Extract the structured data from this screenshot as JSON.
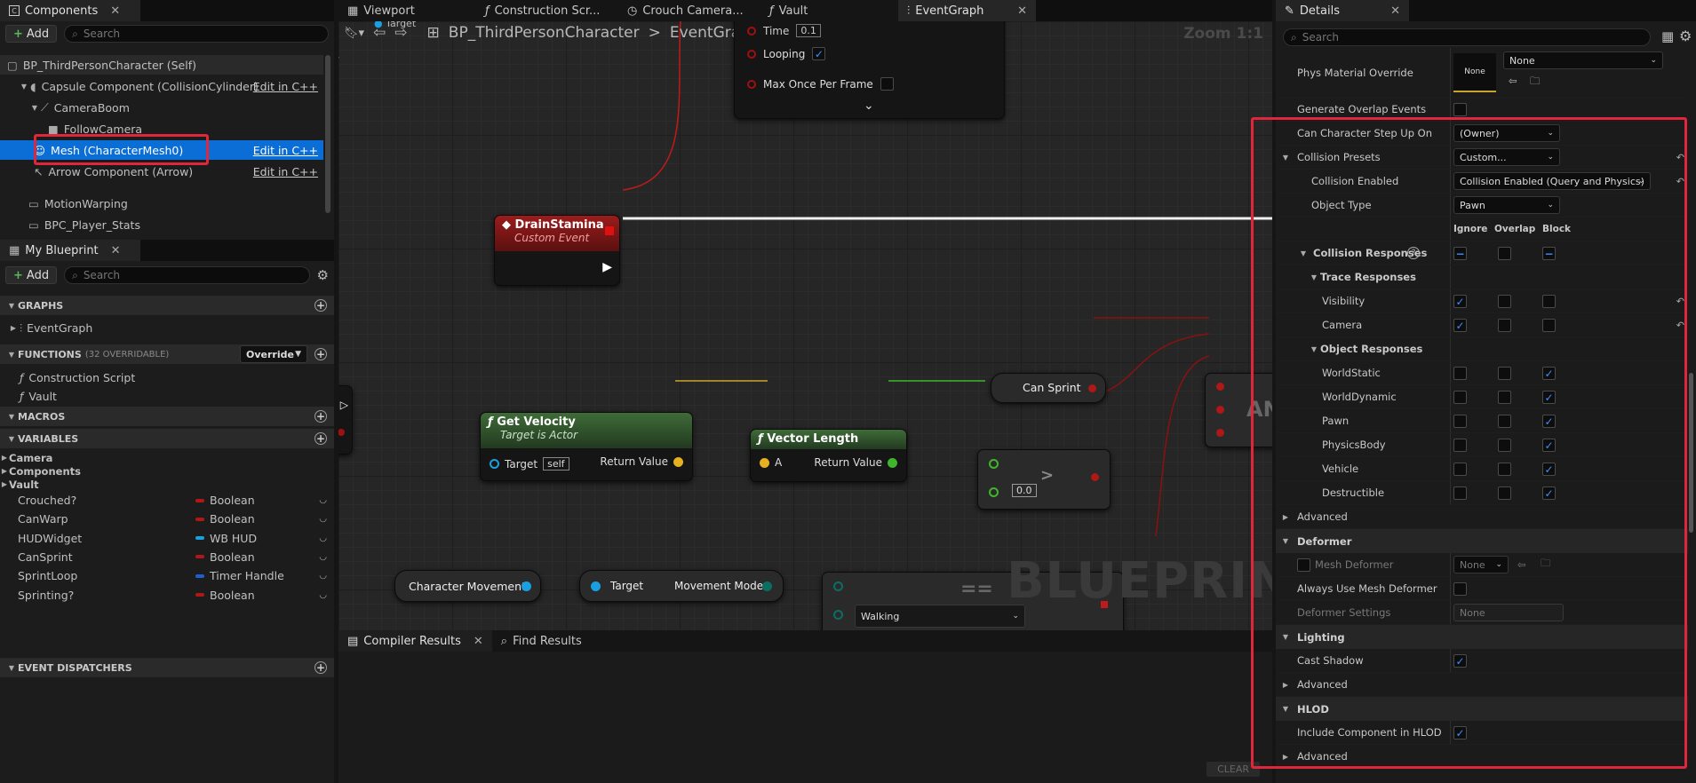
{
  "components": {
    "tab_label": "Components",
    "add_label": "Add",
    "search_placeholder": "Search",
    "items": [
      {
        "label": "BP_ThirdPersonCharacter (Self)",
        "edit": ""
      },
      {
        "label": "Capsule Component (CollisionCylinder)",
        "edit": "Edit in C++"
      },
      {
        "label": "CameraBoom",
        "edit": ""
      },
      {
        "label": "FollowCamera",
        "edit": ""
      },
      {
        "label": "Mesh (CharacterMesh0)",
        "edit": "Edit in C++"
      },
      {
        "label": "Arrow Component (Arrow)",
        "edit": "Edit in C++"
      },
      {
        "label": "MotionWarping",
        "edit": ""
      },
      {
        "label": "BPC_Player_Stats",
        "edit": ""
      }
    ]
  },
  "my_blueprint": {
    "tab_label": "My Blueprint",
    "add_label": "Add",
    "search_placeholder": "Search",
    "graphs_label": "GRAPHS",
    "graph_items": [
      "EventGraph"
    ],
    "functions_label": "FUNCTIONS",
    "functions_count": "(32 OVERRIDABLE)",
    "override_label": "Override",
    "function_items": [
      "Construction Script",
      "Vault"
    ],
    "macros_label": "MACROS",
    "variables_label": "VARIABLES",
    "categories": [
      "Camera",
      "Components",
      "Vault"
    ],
    "variables": [
      {
        "name": "Crouched?",
        "type": "Boolean",
        "color": "#b01818"
      },
      {
        "name": "CanWarp",
        "type": "Boolean",
        "color": "#b01818"
      },
      {
        "name": "HUDWidget",
        "type": "WB HUD",
        "color": "#1aa0e0"
      },
      {
        "name": "CanSprint",
        "type": "Boolean",
        "color": "#b01818"
      },
      {
        "name": "SprintLoop",
        "type": "Timer Handle",
        "color": "#1e5fd0"
      },
      {
        "name": "Sprinting?",
        "type": "Boolean",
        "color": "#b01818"
      }
    ],
    "dispatchers_label": "EVENT DISPATCHERS"
  },
  "editor_tabs": [
    "Viewport",
    "Construction Scr...",
    "Crouch Camera...",
    "Vault",
    "EventGraph"
  ],
  "breadcrumb": {
    "root": "BP_ThirdPersonCharacter",
    "separator": ">",
    "current": "EventGraph"
  },
  "zoom": "Zoom 1:1",
  "watermark": "BLUEPRINT",
  "graph": {
    "timer_rows": [
      "Time",
      "Looping",
      "Max Once Per Frame"
    ],
    "timer_time_value": "0.1",
    "top_target_label": "Target",
    "drain": {
      "title": "DrainStamina",
      "subtitle": "Custom Event"
    },
    "get_velocity": {
      "title": "Get Velocity",
      "subtitle": "Target is Actor",
      "target": "Target",
      "self": "self",
      "ret": "Return Value"
    },
    "vector_length": {
      "title": "Vector Length",
      "a": "A",
      "ret": "Return Value"
    },
    "greater": {
      "symbol": ">",
      "value": "0.0"
    },
    "can_sprint": "Can Sprint",
    "and_partial": "AN",
    "char_movement": "Character Movement",
    "movement_mode": {
      "target": "Target",
      "ret": "Movement Mode"
    },
    "walking": "Walking",
    "eq_partial": "=="
  },
  "bottom": {
    "compiler_tab": "Compiler Results",
    "find_tab": "Find Results",
    "clear_label": "CLEAR"
  },
  "details": {
    "tab_label": "Details",
    "search_placeholder": "Search",
    "phys_material_label": "Phys Material Override",
    "phys_thumb": "None",
    "phys_value": "None",
    "generate_overlap_label": "Generate Overlap Events",
    "can_step_label": "Can Character Step Up On",
    "can_step_value": "(Owner)",
    "collision_presets_label": "Collision Presets",
    "collision_presets_value": "Custom...",
    "collision_enabled_label": "Collision Enabled",
    "collision_enabled_value": "Collision Enabled (Query and Physics)",
    "object_type_label": "Object Type",
    "object_type_value": "Pawn",
    "col_headers": [
      "Ignore",
      "Overlap",
      "Block"
    ],
    "collision_responses_label": "Collision Responses",
    "trace_responses_label": "Trace Responses",
    "trace_rows": [
      {
        "name": "Visibility",
        "state": 0,
        "reset": true
      },
      {
        "name": "Camera",
        "state": 0,
        "reset": true
      }
    ],
    "object_responses_label": "Object Responses",
    "object_rows": [
      {
        "name": "WorldStatic",
        "state": 2
      },
      {
        "name": "WorldDynamic",
        "state": 2
      },
      {
        "name": "Pawn",
        "state": 2
      },
      {
        "name": "PhysicsBody",
        "state": 2
      },
      {
        "name": "Vehicle",
        "state": 2
      },
      {
        "name": "Destructible",
        "state": 2
      }
    ],
    "advanced_label": "Advanced",
    "deformer_label": "Deformer",
    "mesh_deformer_label": "Mesh Deformer",
    "mesh_deformer_value": "None",
    "always_use_label": "Always Use Mesh Deformer",
    "deformer_settings_label": "Deformer Settings",
    "deformer_settings_value": "None",
    "lighting_label": "Lighting",
    "cast_shadow_label": "Cast Shadow",
    "hlod_label": "HLOD",
    "include_hlod_label": "Include Component in HLOD"
  }
}
